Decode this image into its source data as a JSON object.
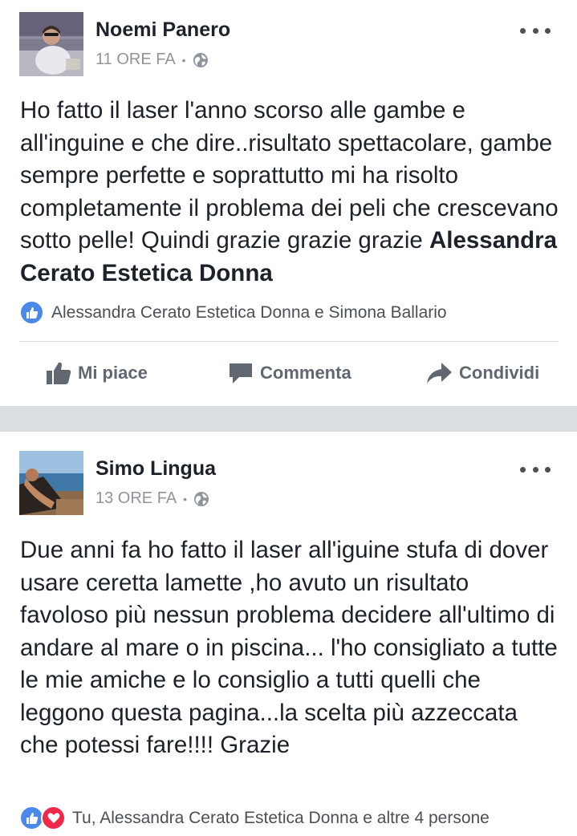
{
  "posts": [
    {
      "author": "Noemi Panero",
      "time": "11 ORE FA",
      "separator": "•",
      "text_plain": "Ho fatto il laser l'anno scorso alle gambe e all'inguine e che dire..risultato spettacolare, gambe sempre perfette e soprattutto mi ha risolto completamente il problema dei peli che crescevano sotto pelle! Quindi grazie grazie grazie ",
      "text_tag": "Alessandra Cerato Estetica Donna",
      "reactions_text": "Alessandra Cerato Estetica Donna e Simona Ballario",
      "actions": {
        "like": "Mi piace",
        "comment": "Commenta",
        "share": "Condividi"
      }
    },
    {
      "author": "Simo Lingua",
      "time": "13 ORE FA",
      "separator": "•",
      "text_plain": "Due anni fa ho fatto il laser all'iguine stufa di dover usare ceretta lamette ,ho avuto un risultato favoloso più nessun problema decidere all'ultimo di andare al mare o in piscina... l'ho consigliato a tutte le mie amiche e lo consiglio a tutti quelli che leggono questa pagina...la scelta più azzeccata che potessi fare!!!! Grazie",
      "reactions_text": "Tu, Alessandra Cerato Estetica Donna e altre 4 persone"
    }
  ],
  "colors": {
    "like_blue": "#4a89e8",
    "love_red": "#f0284a",
    "separator_gray": "#dadde1",
    "meta_gray": "#90949c"
  },
  "icons": [
    "globe-icon",
    "more-options-icon",
    "like-reaction-icon",
    "love-reaction-icon",
    "thumbs-up-icon",
    "comment-icon",
    "share-icon"
  ]
}
